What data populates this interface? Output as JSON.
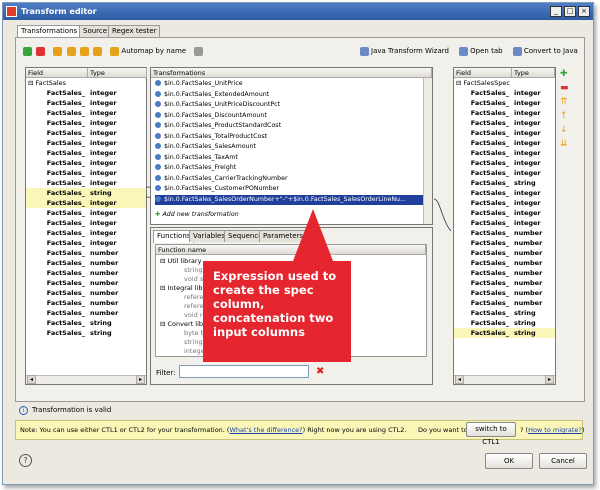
{
  "window": {
    "title": "Transform editor"
  },
  "tabs": [
    "Transformations",
    "Source",
    "Regex tester"
  ],
  "toolbar": {
    "automap": "Automap by name",
    "java_wizard": "Java Transform Wizard",
    "open_tab": "Open tab",
    "convert": "Convert to Java"
  },
  "left_panel": {
    "col_field": "Field",
    "col_type": "Type",
    "root": "FactSales",
    "rows": [
      {
        "field": "FactSales_",
        "type": "integer"
      },
      {
        "field": "FactSales_",
        "type": "integer"
      },
      {
        "field": "FactSales_",
        "type": "integer"
      },
      {
        "field": "FactSales_",
        "type": "integer"
      },
      {
        "field": "FactSales_",
        "type": "integer"
      },
      {
        "field": "FactSales_",
        "type": "integer"
      },
      {
        "field": "FactSales_",
        "type": "integer"
      },
      {
        "field": "FactSales_",
        "type": "integer"
      },
      {
        "field": "FactSales_",
        "type": "integer"
      },
      {
        "field": "FactSales_",
        "type": "integer"
      },
      {
        "field": "FactSales_",
        "type": "string"
      },
      {
        "field": "FactSales_",
        "type": "integer"
      },
      {
        "field": "FactSales_",
        "type": "integer"
      },
      {
        "field": "FactSales_",
        "type": "integer"
      },
      {
        "field": "FactSales_",
        "type": "integer"
      },
      {
        "field": "FactSales_",
        "type": "integer"
      },
      {
        "field": "FactSales_",
        "type": "number"
      },
      {
        "field": "FactSales_",
        "type": "number"
      },
      {
        "field": "FactSales_",
        "type": "number"
      },
      {
        "field": "FactSales_",
        "type": "number"
      },
      {
        "field": "FactSales_",
        "type": "number"
      },
      {
        "field": "FactSales_",
        "type": "number"
      },
      {
        "field": "FactSales_",
        "type": "number"
      },
      {
        "field": "FactSales_",
        "type": "string"
      },
      {
        "field": "FactSales_",
        "type": "string"
      }
    ]
  },
  "transformations": {
    "header": "Transformations",
    "items": [
      "$in.0.FactSales_UnitPrice",
      "$in.0.FactSales_ExtendedAmount",
      "$in.0.FactSales_UnitPriceDiscountPct",
      "$in.0.FactSales_DiscountAmount",
      "$in.0.FactSales_ProductStandardCost",
      "$in.0.FactSales_TotalProductCost",
      "$in.0.FactSales_SalesAmount",
      "$in.0.FactSales_TaxAmt",
      "$in.0.FactSales_Freight",
      "$in.0.FactSales_CarrierTrackingNumber",
      "$in.0.FactSales_CustomerPONumber",
      "$in.0.FactSales_SalesOrderNumber+\"-\"+$in.0.FactSales_SalesOrderLineNu..."
    ],
    "add_new": "Add new transformation"
  },
  "functions": {
    "tabs": [
      "Functions",
      "Variables",
      "Sequences",
      "Parameters"
    ],
    "col_name": "Function name",
    "rows": [
      {
        "indent": 1,
        "text": "Util library"
      },
      {
        "indent": 2,
        "text": "string ra"
      },
      {
        "indent": 2,
        "text": "void slee"
      },
      {
        "indent": 1,
        "text": "Integral libra"
      },
      {
        "indent": 2,
        "text": "reference"
      },
      {
        "indent": 2,
        "text": "reference"
      },
      {
        "indent": 2,
        "text": "void reso"
      },
      {
        "indent": 1,
        "text": "Convert libra"
      },
      {
        "indent": 2,
        "text": "byte bas"
      },
      {
        "indent": 2,
        "text": "string bit"
      },
      {
        "indent": 2,
        "text": "integer bi"
      }
    ],
    "filter_label": "Filter:",
    "filter_value": ""
  },
  "right_panel": {
    "col_field": "Field",
    "col_type": "Type",
    "root": "FactSalesSpec",
    "rows": [
      {
        "field": "FactSales_",
        "type": "integer"
      },
      {
        "field": "FactSales_",
        "type": "integer"
      },
      {
        "field": "FactSales_",
        "type": "integer"
      },
      {
        "field": "FactSales_",
        "type": "integer"
      },
      {
        "field": "FactSales_",
        "type": "integer"
      },
      {
        "field": "FactSales_",
        "type": "integer"
      },
      {
        "field": "FactSales_",
        "type": "integer"
      },
      {
        "field": "FactSales_",
        "type": "integer"
      },
      {
        "field": "FactSales_",
        "type": "integer"
      },
      {
        "field": "FactSales_",
        "type": "string"
      },
      {
        "field": "FactSales_",
        "type": "integer"
      },
      {
        "field": "FactSales_",
        "type": "integer"
      },
      {
        "field": "FactSales_",
        "type": "integer"
      },
      {
        "field": "FactSales_",
        "type": "integer"
      },
      {
        "field": "FactSales_",
        "type": "number"
      },
      {
        "field": "FactSales_",
        "type": "number"
      },
      {
        "field": "FactSales_",
        "type": "number"
      },
      {
        "field": "FactSales_",
        "type": "number"
      },
      {
        "field": "FactSales_",
        "type": "number"
      },
      {
        "field": "FactSales_",
        "type": "number"
      },
      {
        "field": "FactSales_",
        "type": "number"
      },
      {
        "field": "FactSales_",
        "type": "number"
      },
      {
        "field": "FactSales_",
        "type": "string"
      },
      {
        "field": "FactSales_",
        "type": "string"
      },
      {
        "field": "FactSales_",
        "type": "string"
      }
    ]
  },
  "status": {
    "text": "Transformation is valid"
  },
  "note": {
    "prefix": "Note: You can use either CTL1 or CTL2 for your transformation. (",
    "link1": "What's the difference?",
    "middle": ") Right now you are using CTL2.",
    "question": "Do you want to",
    "switch_btn": "switch to CTL1",
    "q2": "? (",
    "link2": "How to migrate?",
    "suffix": ")"
  },
  "callout": "Expression used to create the spec column, concatenation two input columns",
  "buttons": {
    "ok": "OK",
    "cancel": "Cancel"
  },
  "colors": {
    "highlight": "#f9f6b8",
    "callout": "#e5262f",
    "selected": "#1f3f9a"
  }
}
